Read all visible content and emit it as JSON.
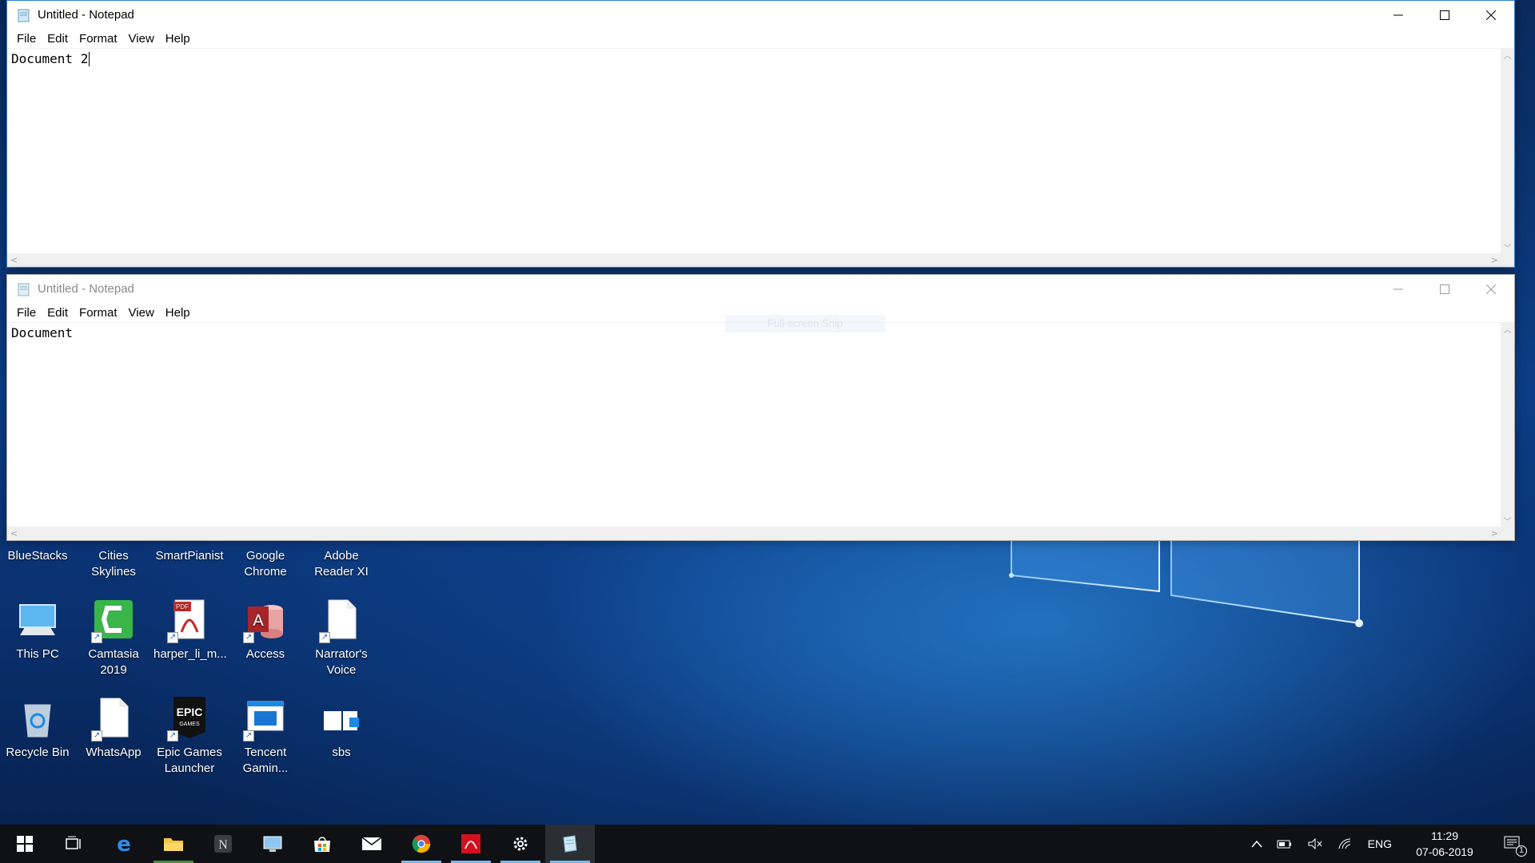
{
  "desktop": {
    "icons": [
      {
        "label": "BlueStacks",
        "icon": "bluestacks-icon"
      },
      {
        "label": "Cities Skylines",
        "icon": "cities-skylines-icon"
      },
      {
        "label": "SmartPianist",
        "icon": "smartpianist-icon"
      },
      {
        "label": "Google Chrome",
        "icon": "chrome-icon"
      },
      {
        "label": "Adobe Reader XI",
        "icon": "adobe-reader-icon"
      },
      {
        "label": "This PC",
        "icon": "this-pc-icon"
      },
      {
        "label": "Camtasia 2019",
        "icon": "camtasia-icon"
      },
      {
        "label": "harper_li_m...",
        "icon": "pdf-file-icon"
      },
      {
        "label": "Access",
        "icon": "access-icon"
      },
      {
        "label": "Narrator's Voice",
        "icon": "blank-file-icon"
      },
      {
        "label": "Recycle Bin",
        "icon": "recycle-bin-icon"
      },
      {
        "label": "WhatsApp",
        "icon": "blank-file-icon"
      },
      {
        "label": "Epic Games Launcher",
        "icon": "epic-games-icon"
      },
      {
        "label": "Tencent Gamin...",
        "icon": "tencent-gaming-icon"
      },
      {
        "label": "sbs",
        "icon": "sbs-icon"
      }
    ]
  },
  "notepad_top": {
    "title": "Untitled - Notepad",
    "menu": [
      "File",
      "Edit",
      "Format",
      "View",
      "Help"
    ],
    "content": "Document 2"
  },
  "notepad_bottom": {
    "title": "Untitled - Notepad",
    "menu": [
      "File",
      "Edit",
      "Format",
      "View",
      "Help"
    ],
    "content": "Document",
    "snip_hint": "Full-screen Snip"
  },
  "taskbar": {
    "apps": [
      {
        "name": "start",
        "icon": "windows-start-icon"
      },
      {
        "name": "task-view",
        "icon": "task-view-icon"
      },
      {
        "name": "edge",
        "icon": "edge-icon"
      },
      {
        "name": "file-explorer",
        "icon": "file-explorer-icon"
      },
      {
        "name": "notion",
        "icon": "notion-icon"
      },
      {
        "name": "remote-desktop",
        "icon": "remote-desktop-icon"
      },
      {
        "name": "store",
        "icon": "store-icon"
      },
      {
        "name": "mail",
        "icon": "mail-icon"
      },
      {
        "name": "chrome",
        "icon": "chrome-icon"
      },
      {
        "name": "acrobat",
        "icon": "acrobat-icon"
      },
      {
        "name": "settings",
        "icon": "gear-icon"
      },
      {
        "name": "notepad",
        "icon": "notepad-icon"
      }
    ],
    "tray": {
      "language": "ENG",
      "time": "11:29",
      "date": "07-06-2019",
      "notification_count": "1"
    }
  },
  "colors": {
    "taskbar": "#0f1115",
    "accent": "#76b9ed",
    "window_border_active": "#2b7fd3"
  }
}
